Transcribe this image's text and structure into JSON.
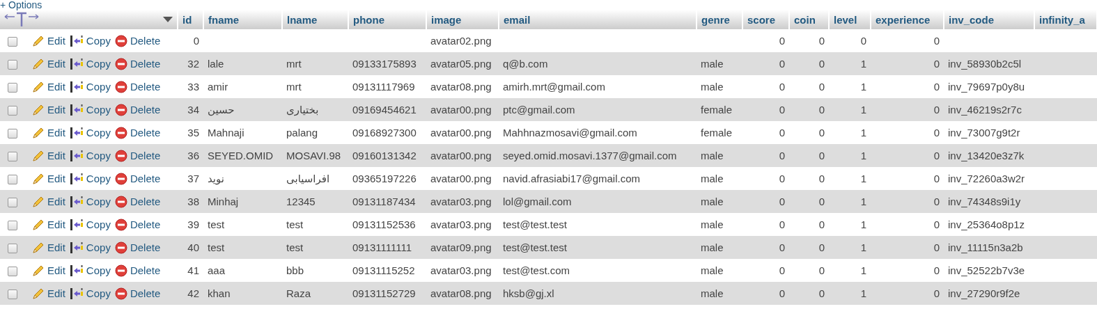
{
  "options": "+ Options",
  "columns": [
    {
      "label": "id",
      "kind": "number"
    },
    {
      "label": "fname",
      "kind": "text"
    },
    {
      "label": "lname",
      "kind": "text"
    },
    {
      "label": "phone",
      "kind": "text"
    },
    {
      "label": "image",
      "kind": "text"
    },
    {
      "label": "email",
      "kind": "text"
    },
    {
      "label": "genre",
      "kind": "text"
    },
    {
      "label": "score",
      "kind": "number"
    },
    {
      "label": "coin",
      "kind": "number"
    },
    {
      "label": "level",
      "kind": "number"
    },
    {
      "label": "experience",
      "kind": "number"
    },
    {
      "label": "inv_code",
      "kind": "text"
    },
    {
      "label": "infinity_a",
      "kind": "text"
    }
  ],
  "rows": [
    {
      "checked": false,
      "actions": [
        "Edit",
        "Copy",
        "Delete"
      ],
      "cells": [
        "0",
        null,
        null,
        null,
        "avatar02.png",
        null,
        null,
        "0",
        "0",
        "0",
        "0",
        null,
        null
      ]
    },
    {
      "checked": false,
      "actions": [
        "Edit",
        "Copy",
        "Delete"
      ],
      "cells": [
        "32",
        "lale",
        "mrt",
        "09133175893",
        "avatar05.png",
        "q@b.com",
        "male",
        "0",
        "0",
        "1",
        "0",
        "inv_58930b2c5l",
        null
      ]
    },
    {
      "checked": false,
      "actions": [
        "Edit",
        "Copy",
        "Delete"
      ],
      "cells": [
        "33",
        "amir",
        "mrt",
        "09131117969",
        "avatar08.png",
        "amirh.mrt@gmail.com",
        "male",
        "0",
        "0",
        "1",
        "0",
        "inv_79697p0y8u",
        null
      ]
    },
    {
      "checked": false,
      "actions": [
        "Edit",
        "Copy",
        "Delete"
      ],
      "cells": [
        "34",
        "حسین",
        "بختیاری",
        "09169454621",
        "avatar00.png",
        "ptc@gmail.com",
        "female",
        "0",
        "0",
        "1",
        "0",
        "inv_46219s2r7c",
        null
      ]
    },
    {
      "checked": false,
      "actions": [
        "Edit",
        "Copy",
        "Delete"
      ],
      "cells": [
        "35",
        "Mahnaji",
        "palang",
        "09168927300",
        "avatar00.png",
        "Mahhnazmosavi@gmail.com",
        "female",
        "0",
        "0",
        "1",
        "0",
        "inv_73007g9t2r",
        null
      ]
    },
    {
      "checked": false,
      "actions": [
        "Edit",
        "Copy",
        "Delete"
      ],
      "cells": [
        "36",
        "SEYED.OMID",
        "MOSAVI.98",
        "09160131342",
        "avatar00.png",
        "seyed.omid.mosavi.1377@gmail.com",
        "male",
        "0",
        "0",
        "1",
        "0",
        "inv_13420e3z7k",
        null
      ]
    },
    {
      "checked": false,
      "actions": [
        "Edit",
        "Copy",
        "Delete"
      ],
      "cells": [
        "37",
        "نوید",
        "افراسیابی",
        "09365197226",
        "avatar00.png",
        "navid.afrasiabi17@gmail.com",
        "male",
        "0",
        "0",
        "1",
        "0",
        "inv_72260a3w2r",
        null
      ]
    },
    {
      "checked": false,
      "actions": [
        "Edit",
        "Copy",
        "Delete"
      ],
      "cells": [
        "38",
        "Minhaj",
        "12345",
        "09131187434",
        "avatar03.png",
        "lol@gmail.com",
        "male",
        "0",
        "0",
        "1",
        "0",
        "inv_74348s9i1y",
        null
      ]
    },
    {
      "checked": false,
      "actions": [
        "Edit",
        "Copy",
        "Delete"
      ],
      "cells": [
        "39",
        "test",
        "test",
        "09131152536",
        "avatar03.png",
        "test@test.test",
        "male",
        "0",
        "0",
        "1",
        "0",
        "inv_25364o8p1z",
        null
      ]
    },
    {
      "checked": false,
      "actions": [
        "Edit",
        "Copy",
        "Delete"
      ],
      "cells": [
        "40",
        "test",
        "test",
        "09131111111",
        "avatar09.png",
        "test@test.test",
        "male",
        "0",
        "0",
        "1",
        "0",
        "inv_11115n3a2b",
        null
      ]
    },
    {
      "checked": false,
      "actions": [
        "Edit",
        "Copy",
        "Delete"
      ],
      "cells": [
        "41",
        "aaa",
        "bbb",
        "09131115252",
        "avatar03.png",
        "test@test.com",
        "male",
        "0",
        "0",
        "1",
        "0",
        "inv_52522b7v3e",
        null
      ]
    },
    {
      "checked": false,
      "actions": [
        "Edit",
        "Copy",
        "Delete"
      ],
      "cells": [
        "42",
        "khan",
        "Raza",
        "09131152729",
        "avatar08.png",
        "hksb@gj.xl",
        "male",
        "0",
        "0",
        "1",
        "0",
        "inv_27290r9f2e",
        null
      ]
    }
  ]
}
